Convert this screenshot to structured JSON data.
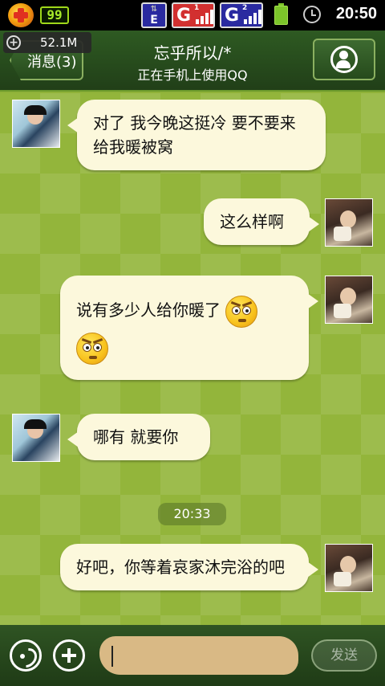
{
  "status_bar": {
    "battery_percent": "99",
    "net_e": "E",
    "net_g": "G",
    "net_g1_num": "1",
    "net_g2_num": "2",
    "time": "20:50",
    "icons": [
      "app-icon",
      "battery-percent-icon",
      "edge-network-icon",
      "gprs-signal-1-icon",
      "gprs-signal-2-icon",
      "battery-icon",
      "alarm-icon"
    ]
  },
  "titlebar": {
    "back_label": "消息(3)",
    "memory": "52.1M",
    "title": "忘乎所以/*",
    "subtitle": "正在手机上使用QQ"
  },
  "messages": [
    {
      "side": "left",
      "text": "对了  我今晚这挺冷   要不要来给我暖被窝"
    },
    {
      "side": "right",
      "text": "这么样啊"
    },
    {
      "side": "right",
      "text": "说有多少人给你暖了",
      "emojis": [
        "angry-face-emoji",
        "angry-face-emoji"
      ]
    },
    {
      "side": "left",
      "text": "哪有  就要你"
    },
    {
      "side": "right",
      "text": "好吧，你等着哀家沐完浴的吧"
    }
  ],
  "timestamp": "20:33",
  "input_bar": {
    "input_value": "",
    "send_label": "发送"
  },
  "colors": {
    "chat_bg": "#93b53b",
    "bubble": "#fcf8dc",
    "titlebar": "#2e5a22",
    "input_field": "#d9b985"
  }
}
